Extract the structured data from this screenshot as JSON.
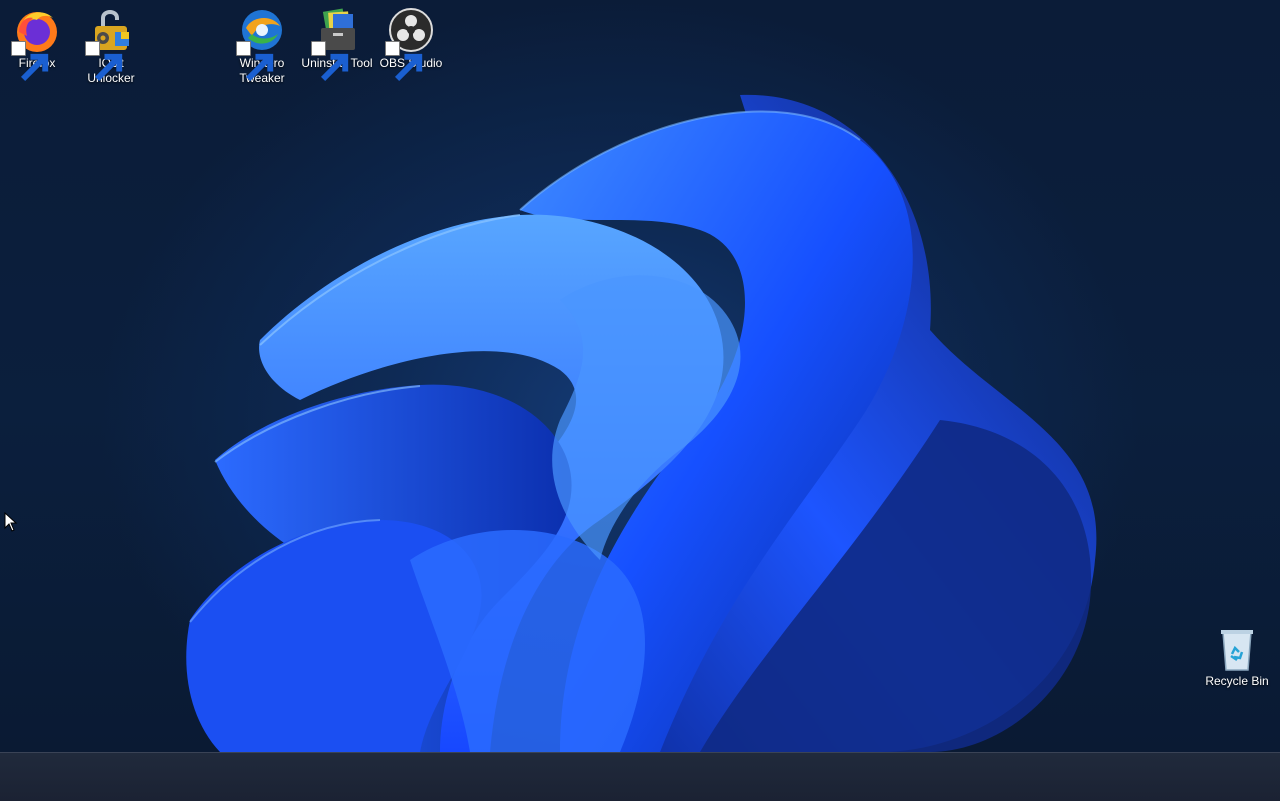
{
  "desktop": {
    "icons": [
      {
        "label": "Firefox",
        "icon": "firefox-icon"
      },
      {
        "label": "IObit\nUnlocker",
        "icon": "iobit-unlocker-icon"
      },
      {
        "label": "Winaero\nTweaker",
        "icon": "winaero-tweaker-icon"
      },
      {
        "label": "Uninstall Tool",
        "icon": "uninstall-tool-icon"
      },
      {
        "label": "OBS Studio",
        "icon": "obs-studio-icon"
      },
      {
        "label": "Recycle Bin",
        "icon": "recycle-bin-icon"
      }
    ]
  },
  "colors": {
    "background": "#0a1a33",
    "bloom_accent": "#1e5bff",
    "taskbar": "#1f2738"
  }
}
